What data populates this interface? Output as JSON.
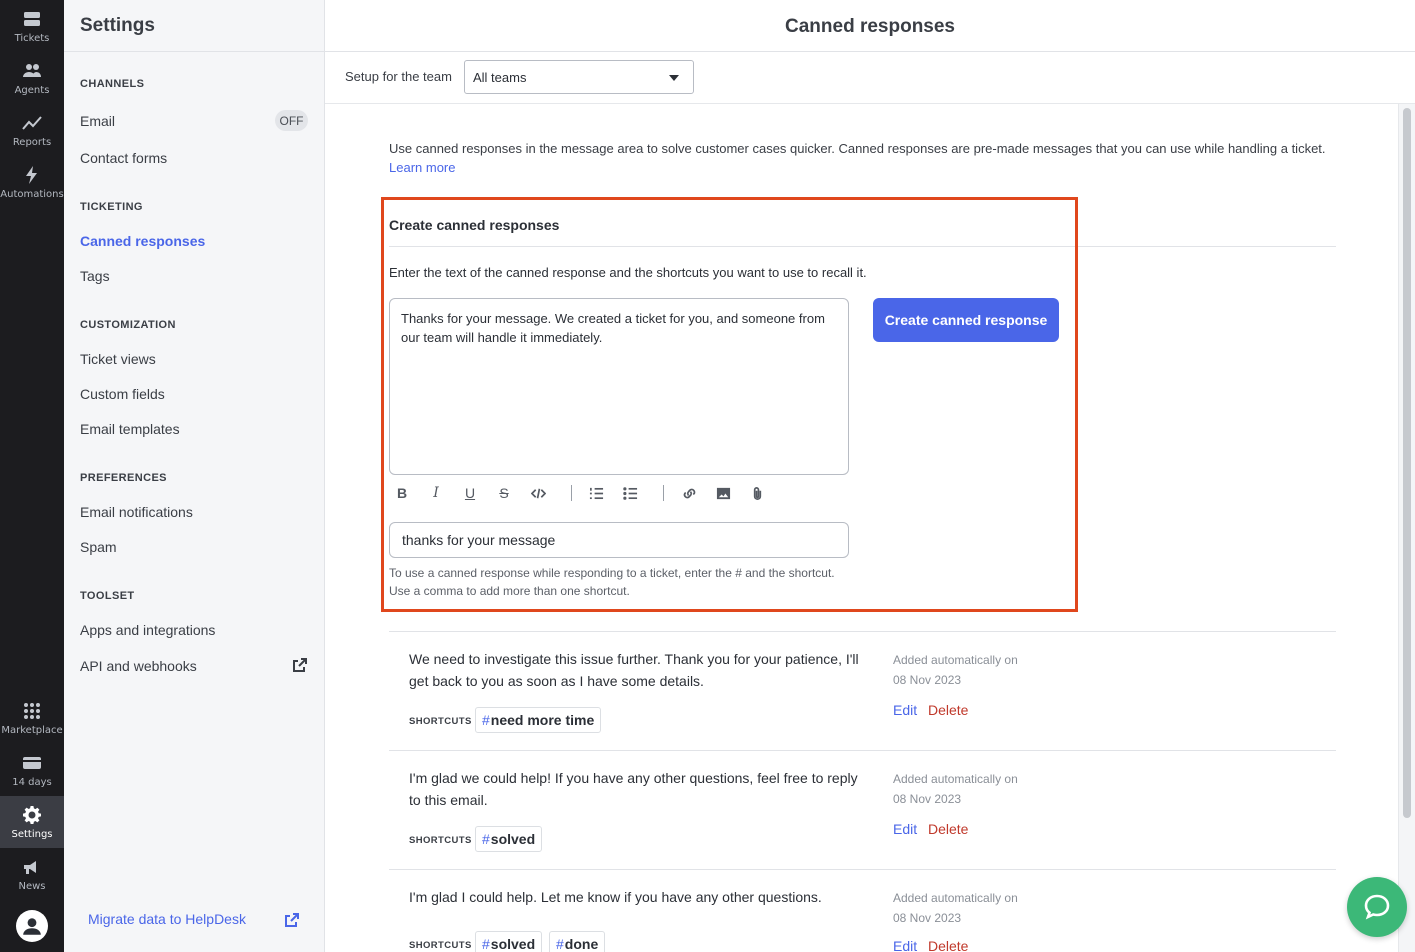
{
  "rail": {
    "tickets": "Tickets",
    "agents": "Agents",
    "reports": "Reports",
    "automations": "Automations",
    "marketplace": "Marketplace",
    "trial": "14 days",
    "settings": "Settings",
    "news": "News"
  },
  "sidebar": {
    "title": "Settings",
    "sections": {
      "channels": "CHANNELS",
      "ticketing": "TICKETING",
      "customization": "CUSTOMIZATION",
      "preferences": "PREFERENCES",
      "toolset": "TOOLSET"
    },
    "items": {
      "email": "Email",
      "email_badge": "OFF",
      "contact_forms": "Contact forms",
      "canned_responses": "Canned responses",
      "tags": "Tags",
      "ticket_views": "Ticket views",
      "custom_fields": "Custom fields",
      "email_templates": "Email templates",
      "email_notifications": "Email notifications",
      "spam": "Spam",
      "apps_integrations": "Apps and integrations",
      "api_webhooks": "API and webhooks"
    },
    "migrate": "Migrate data to HelpDesk"
  },
  "main": {
    "title": "Canned responses",
    "team_label": "Setup for the team",
    "team_value": "All teams",
    "intro": "Use canned responses in the message area to solve customer cases quicker. Canned responses are pre-made messages that you can use while handling a ticket.",
    "learn_more": "Learn more"
  },
  "create": {
    "title": "Create canned responses",
    "help": "Enter the text of the canned response and the shortcuts you want to use to recall it.",
    "editor_text": "Thanks for your message. We created a ticket for you, and someone from our team will handle it immediately.",
    "button": "Create canned response",
    "shortcut_value": "thanks for your message",
    "hint": "To use a canned response while responding to a ticket, enter the # and the shortcut. Use a comma to add more than one shortcut."
  },
  "responses": [
    {
      "text": "We need to investigate this issue further. Thank you for your patience, I'll get back to you as soon as I have some details.",
      "shortcuts_label": "SHORTCUTS",
      "shortcuts": [
        "need more time"
      ],
      "meta_line1": "Added automatically on",
      "meta_line2": "08 Nov 2023",
      "edit": "Edit",
      "delete": "Delete"
    },
    {
      "text": "I'm glad we could help! If you have any other questions, feel free to reply to this email.",
      "shortcuts_label": "SHORTCUTS",
      "shortcuts": [
        "solved"
      ],
      "meta_line1": "Added automatically on",
      "meta_line2": "08 Nov 2023",
      "edit": "Edit",
      "delete": "Delete"
    },
    {
      "text": "I'm glad I could help. Let me know if you have any other questions.",
      "shortcuts_label": "SHORTCUTS",
      "shortcuts": [
        "solved",
        "done"
      ],
      "meta_line1": "Added automatically on",
      "meta_line2": "08 Nov 2023",
      "edit": "Edit",
      "delete": "Delete"
    }
  ],
  "hash": "#",
  "colors": {
    "accent": "#4a66e8",
    "highlight": "#e0471d",
    "delete": "#c0392b",
    "chat": "#3cb878"
  }
}
